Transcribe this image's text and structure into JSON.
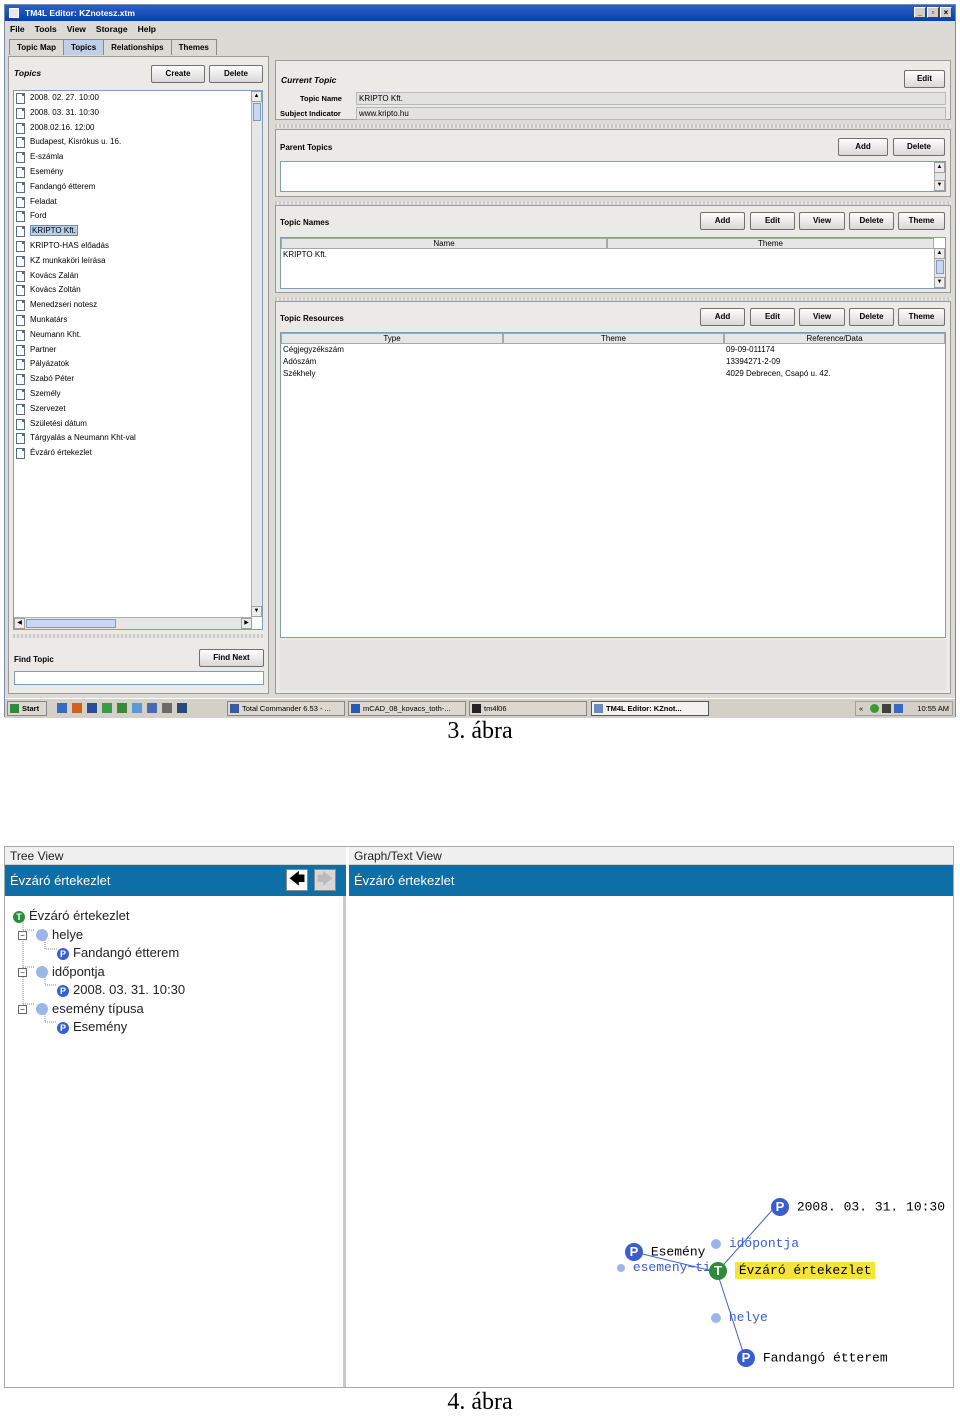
{
  "app": {
    "title": "TM4L Editor: KZnotesz.xtm",
    "menu": [
      "File",
      "Tools",
      "View",
      "Storage",
      "Help"
    ],
    "tabs": [
      "Topic Map",
      "Topics",
      "Relationships",
      "Themes"
    ],
    "active_tab": "Topics"
  },
  "topics_panel": {
    "title": "Topics",
    "create": "Create",
    "delete": "Delete",
    "items": [
      "2008. 02. 27. 10:00",
      "2008. 03. 31. 10:30",
      "2008.02.16. 12:00",
      "Budapest, Kisrókus u. 16.",
      "E-számla",
      "Esemény",
      "Fandangó étterem",
      "Feladat",
      "Ford",
      "KRIPTO Kft.",
      "KRIPTO-HAS előadás",
      "KZ munkaköri leírása",
      "Kovács Zalán",
      "Kovács Zoltán",
      "Menedzseri notesz",
      "Munkatárs",
      "Neumann Kht.",
      "Partner",
      "Pályázatok",
      "Szabó Péter",
      "Személy",
      "Szervezet",
      "Születési dátum",
      "Tárgyalás a Neumann Kht-val",
      "Évzáró értekezlet"
    ],
    "selected": "KRIPTO Kft.",
    "find_label": "Find Topic",
    "find_next": "Find Next",
    "find_value": ""
  },
  "current_topic": {
    "title": "Current Topic",
    "edit": "Edit",
    "name_label": "Topic Name",
    "name_value": "KRIPTO Kft.",
    "subject_label": "Subject Indicator",
    "subject_value": "www.kripto.hu"
  },
  "parent_topics": {
    "title": "Parent Topics",
    "add": "Add",
    "delete": "Delete"
  },
  "topic_names": {
    "title": "Topic Names",
    "buttons": [
      "Add",
      "Edit",
      "View",
      "Delete",
      "Theme"
    ],
    "columns": [
      "Name",
      "Theme"
    ],
    "rows": [
      [
        "KRIPTO Kft.",
        ""
      ]
    ]
  },
  "topic_resources": {
    "title": "Topic Resources",
    "buttons": [
      "Add",
      "Edit",
      "View",
      "Delete",
      "Theme"
    ],
    "columns": [
      "Type",
      "Theme",
      "Reference/Data"
    ],
    "rows": [
      [
        "Cégjegyzékszám",
        "",
        "09-09-011174"
      ],
      [
        "Adószám",
        "",
        "13394271-2-09"
      ],
      [
        "Székhely",
        "",
        "4029 Debrecen, Csapó u. 42."
      ]
    ]
  },
  "taskbar": {
    "start": "Start",
    "items": [
      "Total Commander 6.53 - ...",
      "mCAD_08_kovacs_toth-...",
      "tm4l06",
      "TM4L Editor: KZnot..."
    ],
    "clock": "10:55 AM"
  },
  "caption1": "3. ábra",
  "tree_view": {
    "header": "Tree View",
    "title": "Évzáró értekezlet",
    "nodes": [
      {
        "level": 0,
        "icon": "T",
        "label": "Évzáró értekezlet"
      },
      {
        "level": 1,
        "icon": "A",
        "label": "helye"
      },
      {
        "level": 2,
        "icon": "P",
        "label": "Fandangó étterem"
      },
      {
        "level": 1,
        "icon": "A",
        "label": "időpontja"
      },
      {
        "level": 2,
        "icon": "P",
        "label": "2008. 03. 31. 10:30"
      },
      {
        "level": 1,
        "icon": "A",
        "label": "esemény típusa"
      },
      {
        "level": 2,
        "icon": "P",
        "label": "Esemény"
      }
    ]
  },
  "graph_view": {
    "header": "Graph/Text View",
    "title": "Évzáró értekezlet",
    "center": "Évzáró értekezlet",
    "nodes": {
      "date": "2008. 03. 31. 10:30",
      "idopontja": "időpontja",
      "esemeny": "Esemény",
      "esemeny_tipusa": "esemeny~ti",
      "helye": "helye",
      "fandango": "Fandangó étterem"
    },
    "highlight_color": "#f5e33a"
  },
  "caption2": "4. ábra"
}
